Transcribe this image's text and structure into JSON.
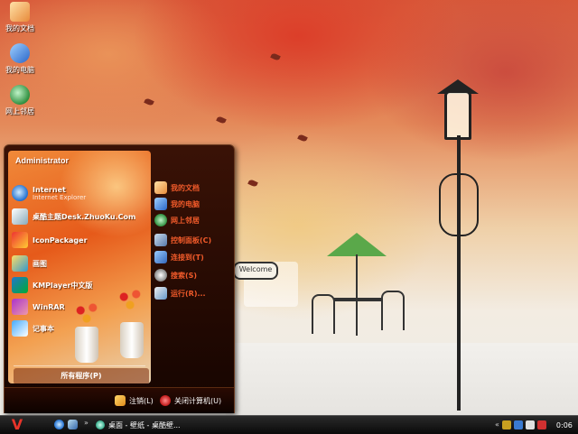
{
  "desktop": {
    "icons": [
      {
        "label": "我的文档",
        "icon": "my-documents-icon"
      },
      {
        "label": "我的电脑",
        "icon": "my-computer-icon"
      },
      {
        "label": "网上邻居",
        "icon": "network-icon"
      }
    ],
    "wallpaper_sign": "Welcome"
  },
  "start_menu": {
    "user_name": "Administrator",
    "pinned": [
      {
        "label": "Internet",
        "sublabel": "Internet Explorer",
        "icon": "internet-explorer-icon"
      },
      {
        "label": "桌酷主题Desk.ZhuoKu.Com",
        "icon": "theme-icon"
      },
      {
        "label": "IconPackager",
        "icon": "iconpackager-icon"
      },
      {
        "label": "画图",
        "icon": "paint-icon"
      },
      {
        "label": "KMPlayer中文版",
        "icon": "kmplayer-icon"
      },
      {
        "label": "WinRAR",
        "icon": "winrar-icon"
      },
      {
        "label": "记事本",
        "icon": "notepad-icon"
      }
    ],
    "all_programs": "所有程序(P)",
    "places": [
      {
        "label": "我的文档",
        "icon": "my-documents-icon"
      },
      {
        "label": "我的电脑",
        "icon": "my-computer-icon"
      },
      {
        "label": "网上邻居",
        "icon": "network-icon"
      },
      {
        "label": "控制面板(C)",
        "icon": "control-panel-icon"
      },
      {
        "label": "连接到(T)",
        "icon": "connect-icon"
      },
      {
        "label": "搜索(S)",
        "icon": "search-icon"
      },
      {
        "label": "运行(R)...",
        "icon": "run-icon"
      }
    ],
    "log_off": "注销(L)",
    "shut_down": "关闭计算机(U)"
  },
  "taskbar": {
    "start_glyph": "V",
    "quick_launch_more": "»",
    "task_label": "桌面 - 壁纸 - 桌酷壁...",
    "tray_expand": "«",
    "clock": "0:06"
  },
  "colors": {
    "accent": "#f05a2a",
    "taskbar": "#1a1a1a",
    "start_glyph": "#e8342a"
  }
}
